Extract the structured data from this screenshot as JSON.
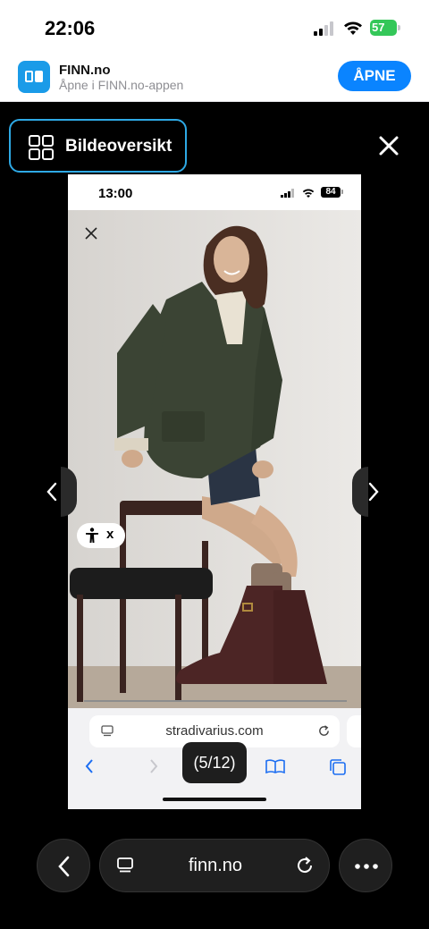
{
  "status_bar": {
    "time": "22:06",
    "battery": "57"
  },
  "app_banner": {
    "title": "FINN.no",
    "subtitle": "Åpne i FINN.no-appen",
    "open_label": "ÅPNE"
  },
  "gallery": {
    "overview_label": "Bildeoversikt",
    "counter": "(5/12)"
  },
  "inner_screenshot": {
    "time": "13:00",
    "battery": "84",
    "a11y_close": "x",
    "url": "stradivarius.com"
  },
  "browser": {
    "url": "finn.no"
  },
  "colors": {
    "accent_blue": "#0a84ff",
    "overview_border": "#2ea9e5",
    "battery_green": "#34c759",
    "jacket": "#3b4434",
    "boots": "#4c2525"
  }
}
